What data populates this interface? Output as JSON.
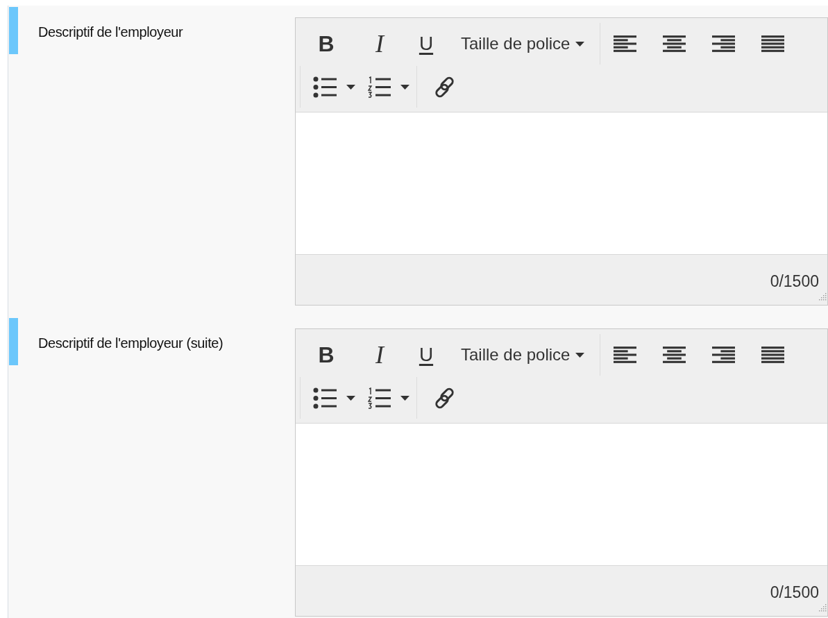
{
  "fields": [
    {
      "label": "Descriptif de l'employeur",
      "toolbar": {
        "bold": "B",
        "italic": "I",
        "underline": "U",
        "font_size": "Taille de police"
      },
      "counter": "0/1500"
    },
    {
      "label": "Descriptif de l'employeur (suite)",
      "toolbar": {
        "bold": "B",
        "italic": "I",
        "underline": "U",
        "font_size": "Taille de police"
      },
      "counter": "0/1500"
    }
  ]
}
